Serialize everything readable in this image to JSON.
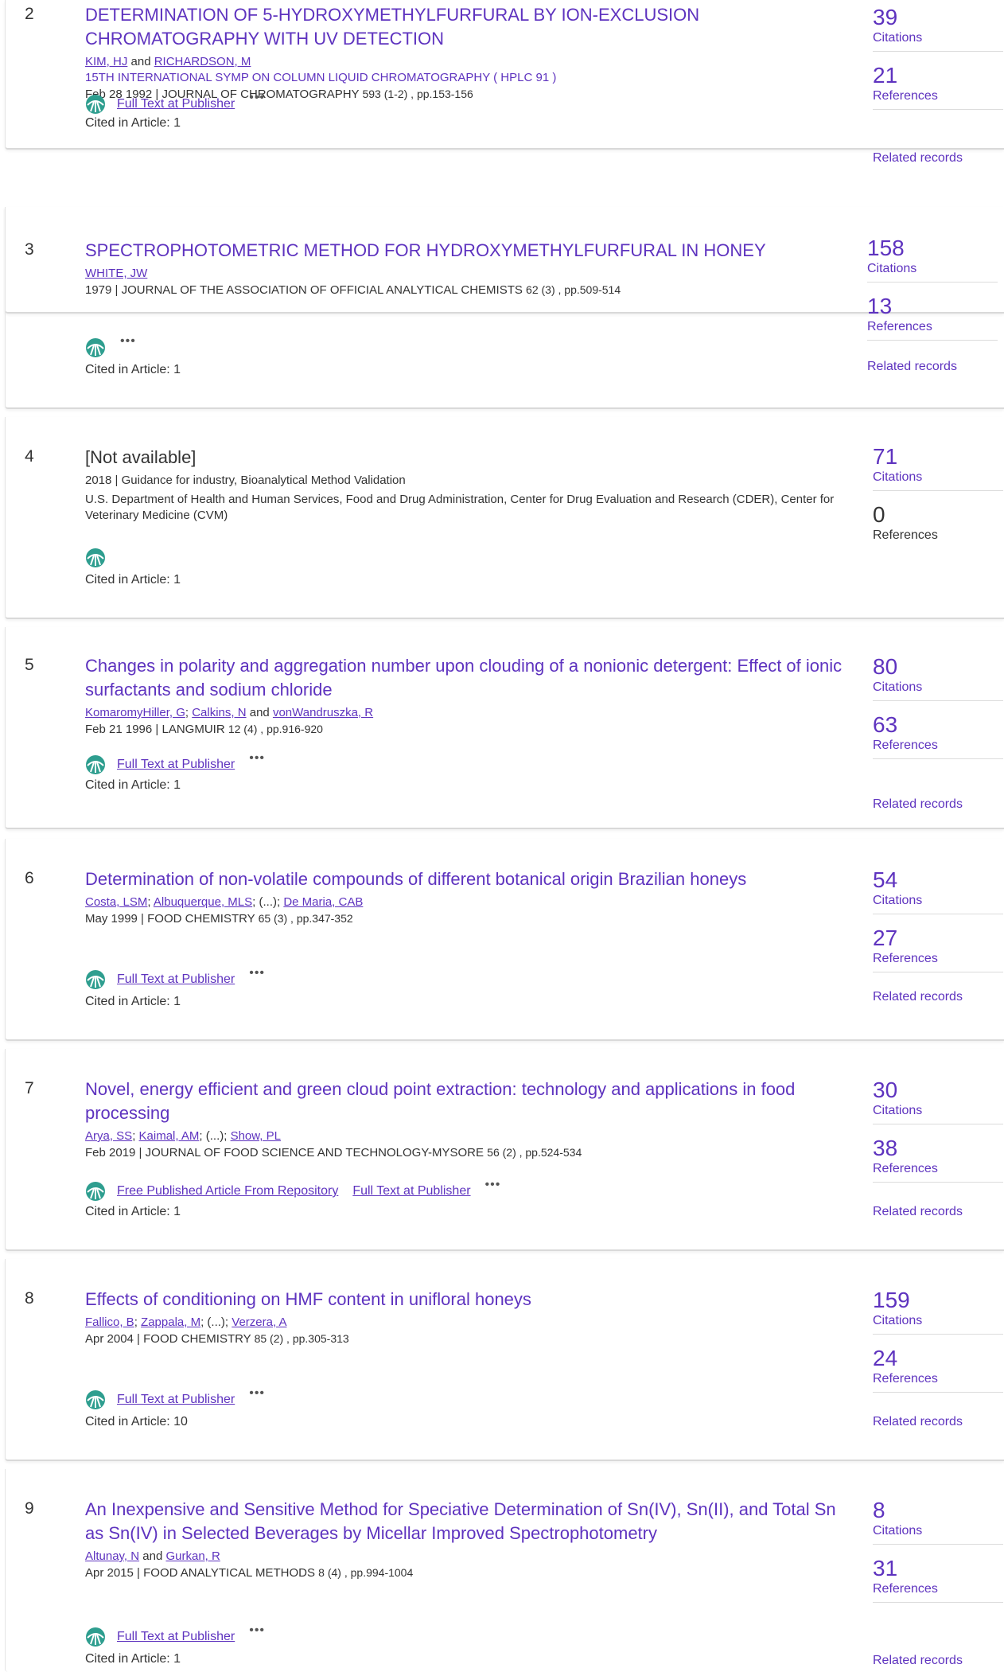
{
  "records": [
    {
      "number": "2",
      "title": "DETERMINATION OF 5-HYDROXYMETHYLFURFURAL BY ION-EXCLUSION CHROMATOGRAPHY WITH UV DETECTION",
      "authors": [
        "KIM, HJ",
        "RICHARDSON, M"
      ],
      "author_sep": " and ",
      "conference": "15TH INTERNATIONAL SYMP ON COLUMN LIQUID CHROMATOGRAPHY ( HPLC 91 )",
      "date": "Feb 28 1992",
      "journal": "JOURNAL OF CHROMATOGRAPHY",
      "volume": "593 (1-2) , pp.153-156",
      "full_text_label": "Full Text at Publisher",
      "cited_in": "Cited in Article: 1",
      "citations": "39",
      "citations_label": "Citations",
      "references": "21",
      "references_label": "References",
      "related": "Related records"
    },
    {
      "number": "3",
      "title": "SPECTROPHOTOMETRIC METHOD FOR HYDROXYMETHYLFURFURAL IN HONEY",
      "authors": [
        "WHITE, JW"
      ],
      "author_sep": "; ",
      "date": "1979",
      "journal": "JOURNAL OF THE ASSOCIATION OF OFFICIAL ANALYTICAL CHEMISTS",
      "volume": "62 (3) , pp.509-514",
      "cited_in": "Cited in Article: 1",
      "citations": "158",
      "citations_label": "Citations",
      "references": "13",
      "references_label": "References",
      "related": "Related records"
    },
    {
      "number": "4",
      "title": "[Not available]",
      "line1": "2018 | Guidance for industry, Bioanalytical Method Validation",
      "line2": "U.S. Department of Health and Human Services, Food and Drug Administration, Center for Drug Evaluation and Research (CDER), Center for Veterinary Medicine (CVM)",
      "cited_in": "Cited in Article: 1",
      "citations": "71",
      "citations_label": "Citations",
      "references": "0",
      "references_label": "References"
    },
    {
      "number": "5",
      "title": "Changes in polarity and aggregation number upon clouding of a nonionic detergent: Effect of ionic surfactants and sodium chloride",
      "authors": [
        "KomaromyHiller, G",
        "Calkins, N",
        "vonWandruszka, R"
      ],
      "author_seps": [
        "; ",
        " and "
      ],
      "date": "Feb 21 1996",
      "journal": "LANGMUIR",
      "volume": "12 (4) , pp.916-920",
      "full_text_label": "Full Text at Publisher",
      "cited_in": "Cited in Article: 1",
      "citations": "80",
      "citations_label": "Citations",
      "references": "63",
      "references_label": "References",
      "related": "Related records"
    },
    {
      "number": "6",
      "title": "Determination of non-volatile compounds of different botanical origin Brazilian honeys",
      "authors": [
        "Costa, LSM",
        "Albuquerque, MLS",
        "De Maria, CAB"
      ],
      "ellipsis": "(...)",
      "date": "May 1999",
      "journal": "FOOD CHEMISTRY",
      "volume": "65 (3) , pp.347-352",
      "full_text_label": "Full Text at Publisher",
      "cited_in": "Cited in Article: 1",
      "citations": "54",
      "citations_label": "Citations",
      "references": "27",
      "references_label": "References",
      "related": "Related records"
    },
    {
      "number": "7",
      "title": "Novel, energy efficient and green cloud point extraction: technology and applications in food processing",
      "authors": [
        "Arya, SS",
        "Kaimal, AM",
        "Show, PL"
      ],
      "ellipsis": "(...)",
      "date": "Feb 2019",
      "journal": "JOURNAL OF FOOD SCIENCE AND TECHNOLOGY-MYSORE",
      "volume": "56 (2) , pp.524-534",
      "repository_label": "Free Published Article From Repository",
      "full_text_label": "Full Text at Publisher",
      "cited_in": "Cited in Article: 1",
      "citations": "30",
      "citations_label": "Citations",
      "references": "38",
      "references_label": "References",
      "related": "Related records"
    },
    {
      "number": "8",
      "title": "Effects of conditioning on HMF content in unifloral honeys",
      "authors": [
        "Fallico, B",
        "Zappala, M",
        "Verzera, A"
      ],
      "ellipsis": "(...)",
      "date": "Apr 2004",
      "journal": "FOOD CHEMISTRY",
      "volume": "85 (2) , pp.305-313",
      "full_text_label": "Full Text at Publisher",
      "cited_in": "Cited in Article: 10",
      "citations": "159",
      "citations_label": "Citations",
      "references": "24",
      "references_label": "References",
      "related": "Related records"
    },
    {
      "number": "9",
      "title": "An Inexpensive and Sensitive Method for Speciative Determination of Sn(IV), Sn(II), and Total Sn as Sn(IV) in Selected Beverages by Micellar Improved Spectrophotometry",
      "authors": [
        "Altunay, N",
        "Gurkan, R"
      ],
      "author_sep": " and ",
      "date": "Apr 2015",
      "journal": "FOOD ANALYTICAL METHODS",
      "volume": "8 (4) , pp.994-1004",
      "full_text_label": "Full Text at Publisher",
      "cited_in": "Cited in Article: 1",
      "citations": "8",
      "citations_label": "Citations",
      "references": "31",
      "references_label": "References",
      "related": "Related records"
    }
  ],
  "more_label": "•••",
  "colors": {
    "link": "#5e33bf",
    "text": "#333333",
    "icon_green": "#2e9e8f"
  },
  "icons": {
    "publisher": "publisher-globe-icon",
    "more": "more-options-icon"
  }
}
